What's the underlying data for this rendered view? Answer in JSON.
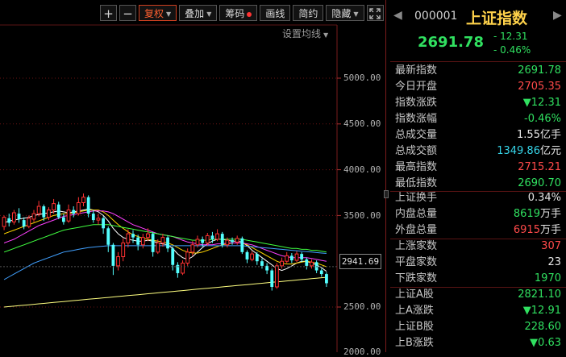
{
  "toolbar": {
    "plus_label": "+",
    "minus_label": "−",
    "fuquan_label": "复权",
    "overlay_label": "叠加",
    "chips_label": "筹码",
    "draw_line_label": "画线",
    "brief_label": "简约",
    "hide_label": "隐藏"
  },
  "chart": {
    "ma_settings_label": "设置均线",
    "current_price_tag": "2941.69",
    "axis_labels": [
      "5000.00",
      "4500.00",
      "4000.00",
      "3500.00",
      "2500.00",
      "2000.00"
    ]
  },
  "chart_data": {
    "type": "candlestick",
    "y_ticks": [
      5000.0,
      4500.0,
      4000.0,
      3500.0,
      2500.0,
      2000.0
    ],
    "ylim": [
      1950,
      5450
    ],
    "current_price_marker": 2941.69,
    "candles": [
      [
        3380,
        3480,
        3340,
        3500
      ],
      [
        3470,
        3420,
        3380,
        3520
      ],
      [
        3430,
        3530,
        3400,
        3560
      ],
      [
        3520,
        3460,
        3420,
        3580
      ],
      [
        3450,
        3380,
        3350,
        3480
      ],
      [
        3380,
        3470,
        3360,
        3500
      ],
      [
        3460,
        3520,
        3430,
        3560
      ],
      [
        3520,
        3600,
        3490,
        3660
      ],
      [
        3600,
        3480,
        3440,
        3620
      ],
      [
        3480,
        3560,
        3450,
        3590
      ],
      [
        3560,
        3630,
        3520,
        3680
      ],
      [
        3620,
        3480,
        3460,
        3650
      ],
      [
        3480,
        3430,
        3400,
        3520
      ],
      [
        3440,
        3560,
        3420,
        3620
      ],
      [
        3560,
        3520,
        3480,
        3600
      ],
      [
        3520,
        3640,
        3500,
        3700
      ],
      [
        3640,
        3700,
        3600,
        3740
      ],
      [
        3700,
        3520,
        3480,
        3720
      ],
      [
        3520,
        3450,
        3420,
        3560
      ],
      [
        3450,
        3470,
        3400,
        3520
      ],
      [
        3470,
        3360,
        3300,
        3490
      ],
      [
        3360,
        3180,
        3100,
        3380
      ],
      [
        3180,
        2950,
        2850,
        3200
      ],
      [
        2950,
        3050,
        2900,
        3100
      ],
      [
        3050,
        3200,
        3000,
        3250
      ],
      [
        3200,
        3300,
        3150,
        3350
      ],
      [
        3300,
        3260,
        3200,
        3340
      ],
      [
        3260,
        3180,
        3120,
        3290
      ],
      [
        3180,
        3260,
        3140,
        3300
      ],
      [
        3260,
        3300,
        3220,
        3360
      ],
      [
        3300,
        3100,
        3050,
        3320
      ],
      [
        3100,
        3200,
        3080,
        3240
      ],
      [
        3200,
        3260,
        3160,
        3300
      ],
      [
        3260,
        3140,
        3100,
        3280
      ],
      [
        3140,
        2960,
        2900,
        3160
      ],
      [
        2960,
        2870,
        2820,
        2990
      ],
      [
        2870,
        2980,
        2850,
        3010
      ],
      [
        2980,
        3100,
        2950,
        3140
      ],
      [
        3100,
        3180,
        3060,
        3220
      ],
      [
        3180,
        3240,
        3150,
        3280
      ],
      [
        3240,
        3200,
        3160,
        3270
      ],
      [
        3200,
        3280,
        3170,
        3310
      ],
      [
        3280,
        3240,
        3200,
        3320
      ],
      [
        3240,
        3300,
        3220,
        3350
      ],
      [
        3300,
        3180,
        3150,
        3320
      ],
      [
        3180,
        3230,
        3150,
        3260
      ],
      [
        3230,
        3210,
        3180,
        3260
      ],
      [
        3210,
        3250,
        3180,
        3280
      ],
      [
        3250,
        3100,
        3080,
        3270
      ],
      [
        3100,
        3020,
        2980,
        3120
      ],
      [
        3020,
        3080,
        3000,
        3110
      ],
      [
        3080,
        3000,
        2960,
        3100
      ],
      [
        3000,
        2950,
        2920,
        3030
      ],
      [
        2950,
        2900,
        2860,
        2980
      ],
      [
        2900,
        2720,
        2680,
        2920
      ],
      [
        2720,
        2950,
        2700,
        2980
      ],
      [
        2950,
        3000,
        2920,
        3040
      ],
      [
        3000,
        3060,
        2980,
        3100
      ],
      [
        3060,
        3010,
        2980,
        3090
      ],
      [
        3010,
        3080,
        2990,
        3110
      ],
      [
        3080,
        3020,
        2990,
        3100
      ],
      [
        3020,
        2950,
        2910,
        3040
      ],
      [
        2950,
        2990,
        2920,
        3020
      ],
      [
        2990,
        2900,
        2870,
        3010
      ],
      [
        2900,
        2860,
        2830,
        2920
      ],
      [
        2860,
        2760,
        2720,
        2880
      ]
    ],
    "ma_lines": [
      {
        "color": "#ffffff",
        "values": [
          3420,
          3440,
          3450,
          3460,
          3470,
          3480,
          3500,
          3510,
          3520,
          3530,
          3540,
          3550,
          3540,
          3530,
          3540,
          3550,
          3560,
          3570,
          3560,
          3540,
          3500,
          3440,
          3360,
          3300,
          3260,
          3240,
          3230,
          3220,
          3220,
          3230,
          3220,
          3200,
          3190,
          3180,
          3140,
          3080,
          3040,
          3020,
          3050,
          3100,
          3150,
          3190,
          3220,
          3240,
          3240,
          3230,
          3220,
          3220,
          3210,
          3170,
          3120,
          3080,
          3040,
          3000,
          2960,
          2920,
          2900,
          2920,
          2950,
          2980,
          3000,
          3000,
          2980,
          2960,
          2930,
          2890
        ]
      },
      {
        "color": "#ffd400",
        "values": [
          3300,
          3320,
          3340,
          3360,
          3380,
          3400,
          3420,
          3440,
          3460,
          3480,
          3500,
          3510,
          3520,
          3520,
          3530,
          3540,
          3550,
          3560,
          3560,
          3560,
          3540,
          3500,
          3450,
          3400,
          3360,
          3320,
          3290,
          3270,
          3250,
          3240,
          3230,
          3220,
          3210,
          3200,
          3180,
          3150,
          3120,
          3100,
          3090,
          3090,
          3100,
          3120,
          3140,
          3160,
          3180,
          3190,
          3200,
          3200,
          3200,
          3180,
          3150,
          3120,
          3090,
          3060,
          3030,
          3000,
          2980,
          2970,
          2970,
          2980,
          2990,
          3000,
          2990,
          2980,
          2960,
          2940
        ]
      },
      {
        "color": "#ff40ff",
        "values": [
          3200,
          3220,
          3240,
          3270,
          3300,
          3330,
          3360,
          3390,
          3410,
          3430,
          3450,
          3470,
          3490,
          3500,
          3510,
          3520,
          3530,
          3540,
          3550,
          3550,
          3550,
          3540,
          3520,
          3490,
          3460,
          3430,
          3400,
          3380,
          3360,
          3340,
          3320,
          3300,
          3290,
          3280,
          3270,
          3250,
          3230,
          3210,
          3200,
          3190,
          3180,
          3180,
          3180,
          3190,
          3190,
          3200,
          3200,
          3200,
          3200,
          3190,
          3180,
          3160,
          3140,
          3120,
          3100,
          3080,
          3060,
          3050,
          3040,
          3040,
          3040,
          3040,
          3030,
          3020,
          3010,
          3000
        ]
      },
      {
        "color": "#40ff40",
        "values": [
          3100,
          3120,
          3140,
          3160,
          3180,
          3200,
          3220,
          3240,
          3260,
          3280,
          3300,
          3320,
          3340,
          3350,
          3360,
          3370,
          3380,
          3390,
          3400,
          3400,
          3400,
          3400,
          3390,
          3380,
          3370,
          3360,
          3350,
          3340,
          3330,
          3320,
          3310,
          3300,
          3290,
          3280,
          3270,
          3260,
          3250,
          3240,
          3230,
          3230,
          3230,
          3230,
          3240,
          3240,
          3240,
          3240,
          3240,
          3240,
          3240,
          3230,
          3220,
          3210,
          3200,
          3190,
          3180,
          3170,
          3160,
          3150,
          3140,
          3140,
          3130,
          3130,
          3120,
          3120,
          3110,
          3100
        ]
      },
      {
        "color": "#40a0ff",
        "values": [
          2800,
          2830,
          2860,
          2890,
          2920,
          2950,
          2980,
          3000,
          3020,
          3040,
          3060,
          3080,
          3100,
          3110,
          3120,
          3130,
          3140,
          3150,
          3155,
          3160,
          3165,
          3170,
          3170,
          3170,
          3170,
          3170,
          3170,
          3170,
          3170,
          3170,
          3170,
          3170,
          3170,
          3170,
          3170,
          3170,
          3170,
          3170,
          3170,
          3170,
          3170,
          3170,
          3170,
          3170,
          3170,
          3170,
          3170,
          3170,
          3170,
          3165,
          3160,
          3155,
          3150,
          3145,
          3140,
          3135,
          3130,
          3125,
          3120,
          3115,
          3110,
          3105,
          3100,
          3095,
          3090,
          3085
        ]
      },
      {
        "color": "#ffff80",
        "values": [
          2500,
          2505,
          2510,
          2515,
          2520,
          2525,
          2530,
          2535,
          2540,
          2545,
          2550,
          2555,
          2560,
          2565,
          2570,
          2575,
          2580,
          2585,
          2590,
          2595,
          2600,
          2605,
          2610,
          2615,
          2620,
          2625,
          2630,
          2635,
          2640,
          2645,
          2650,
          2655,
          2660,
          2665,
          2670,
          2675,
          2680,
          2685,
          2690,
          2695,
          2700,
          2705,
          2710,
          2715,
          2720,
          2725,
          2730,
          2735,
          2740,
          2745,
          2750,
          2755,
          2760,
          2765,
          2770,
          2775,
          2780,
          2785,
          2790,
          2795,
          2800,
          2805,
          2810,
          2815,
          2820,
          2825
        ]
      }
    ]
  },
  "panel": {
    "code": "000001",
    "name": "上证指数",
    "price": "2691.78",
    "change": "- 12.31",
    "change_pct": "- 0.46%",
    "rows_group1": [
      {
        "label": "最新指数",
        "value": "2691.78",
        "color": "green"
      },
      {
        "label": "今日开盘",
        "value": "2705.35",
        "color": "red"
      },
      {
        "label": "指数涨跌",
        "value": "▼12.31",
        "color": "green"
      },
      {
        "label": "指数涨幅",
        "value": "-0.46%",
        "color": "green"
      },
      {
        "label": "总成交量",
        "value": "1.55",
        "unit": "亿手",
        "color": "white"
      },
      {
        "label": "总成交额",
        "value": "1349.86",
        "unit": "亿元",
        "color": "cyan"
      },
      {
        "label": "最高指数",
        "value": "2715.21",
        "color": "red"
      },
      {
        "label": "最低指数",
        "value": "2690.70",
        "color": "green"
      }
    ],
    "rows_group2": [
      {
        "label": "上证换手",
        "value": "0.34%",
        "color": "white"
      },
      {
        "label": "内盘总量",
        "value": "8619",
        "unit": "万手",
        "color": "green"
      },
      {
        "label": "外盘总量",
        "value": "6915",
        "unit": "万手",
        "color": "red"
      }
    ],
    "rows_group3": [
      {
        "label": "上涨家数",
        "value": "307",
        "color": "red"
      },
      {
        "label": "平盘家数",
        "value": "23",
        "color": "white"
      },
      {
        "label": "下跌家数",
        "value": "1970",
        "color": "green"
      }
    ],
    "rows_group4": [
      {
        "label": "上证A股",
        "value": "2821.10",
        "color": "green"
      },
      {
        "label": "上A涨跌",
        "value": "▼12.91",
        "color": "green"
      },
      {
        "label": "上证B股",
        "value": "228.60",
        "color": "green"
      },
      {
        "label": "上B涨跌",
        "value": "▼0.63",
        "color": "green"
      }
    ]
  }
}
